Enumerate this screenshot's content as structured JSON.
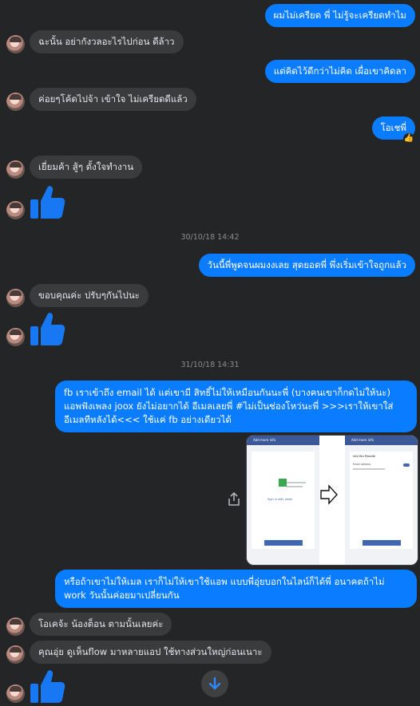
{
  "messages": {
    "m1": "ผมไม่เครียด พี่ ไม่รู้จะเครียดทำไม",
    "m2": "ฉะนั้น อย่ากังวลอะไรไปก่อน ดีล้าว",
    "m3": "แต่คิดไว้ดีกว่าไม่คิด เผื่อเขาคิดลา",
    "m4": "ค่อยๆโค้ดไปจ้า เข้าใจ ไม่เครียดดีแล้ว",
    "m5": "โอเชพี่",
    "m5_reaction": "👍",
    "m6": "เยี่ยมค้า สู้ๆ ตั้งใจทำงาน",
    "ts1": "30/10/18 14:42",
    "m7": "วันนี้พี่พูดจนผมงงเลย สุดยอดพี่ พึ่งเริ่มเข้าใจถูกแล้ว",
    "m8": "ขอบคุณค่ะ ปรับๆกันไปนะ",
    "ts2": "31/10/18 14:31",
    "m9": "fb เราเข้าถึง email ได้ แต่เขามี สิทธิ์ไม่ให้เหมือนกันนะพี่ (บางคนเขาก็กดไม่ให้นะ) แอพฟังเพลง joox ยังไม่อยากได้ อีเมลเลยพี่ #ไม่เป็นช่องโหว่นะพี่ >>>เราให้เขาใส่ อีเมลทีหลังได้<<< ใช้แค่ fb อย่างเดียวได้",
    "m10": "หรือถ้าเขาไม่ให้เมล เราก็ไม่ให้เขาใช้แอพ แบบพี่อุ่ยบอกในไลน์ก็ได้พี่ อนาคตถ้าไม่ work วันนั้นค่อยมาเปลี่ยนกัน",
    "m11": "โอเคจ้ะ น้องต็อน ตามนั้นเลยค่ะ",
    "m12": "คุณอุ่ย ดูเห็นflow มาหลายแอป ใช้ทางส่วนใหญ่ก่อนเนาะ"
  },
  "attachment": {
    "left_title": "Add more info",
    "left_text": "Sign in with email",
    "right_title": "Add more info",
    "right_subtitle": "Info You Provide",
    "right_label": "Email address"
  },
  "colors": {
    "background": "#242526",
    "incoming": "#3a3b3c",
    "outgoing": "#0a7cff",
    "like": "#1877f2"
  },
  "icons": [
    "avatar",
    "like-thumb-icon",
    "share-icon",
    "arrow-down-icon",
    "thumbs-up-reaction-icon"
  ]
}
